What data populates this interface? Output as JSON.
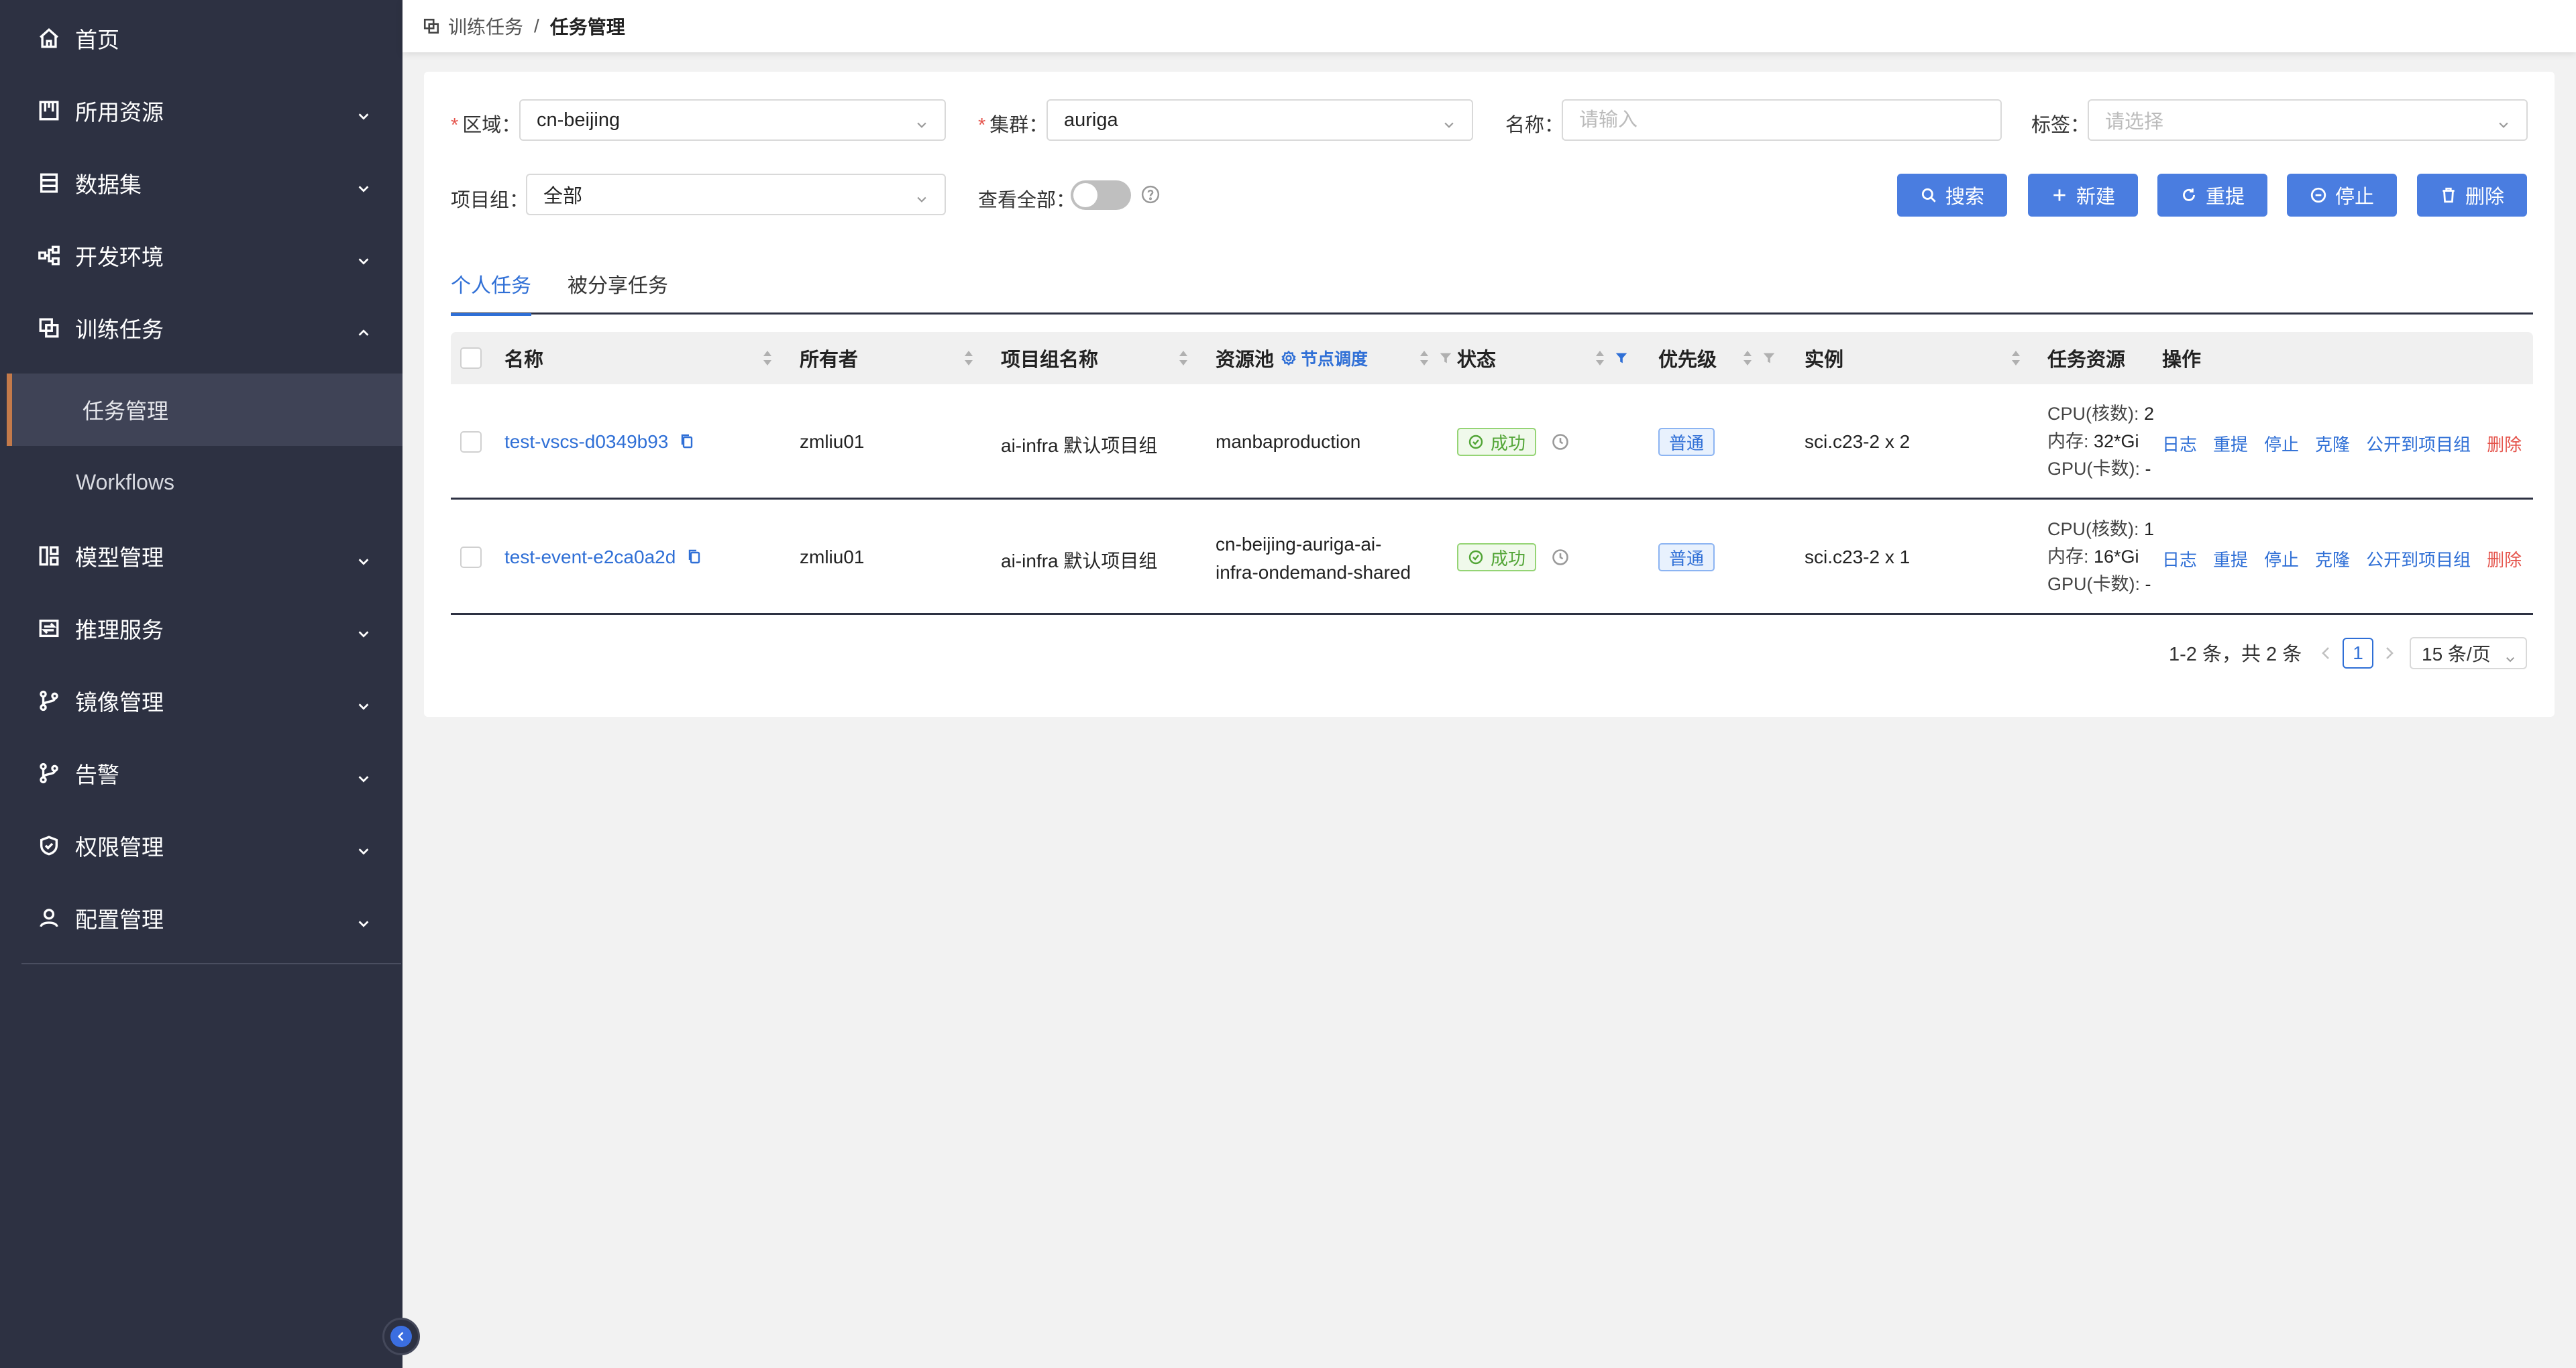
{
  "sidebar": {
    "items": [
      {
        "label": "首页",
        "icon": "home-icon"
      },
      {
        "label": "所用资源",
        "icon": "resource-icon"
      },
      {
        "label": "数据集",
        "icon": "dataset-icon"
      },
      {
        "label": "开发环境",
        "icon": "dev-env-icon"
      },
      {
        "label": "训练任务",
        "icon": "training-icon"
      },
      {
        "label": "模型管理",
        "icon": "model-icon"
      },
      {
        "label": "推理服务",
        "icon": "inference-icon"
      },
      {
        "label": "镜像管理",
        "icon": "image-branch-icon"
      },
      {
        "label": "告警",
        "icon": "alert-branch-icon"
      },
      {
        "label": "权限管理",
        "icon": "shield-icon"
      },
      {
        "label": "配置管理",
        "icon": "user-icon"
      }
    ],
    "sub_items": [
      {
        "label": "任务管理",
        "active": true
      },
      {
        "label": "Workflows",
        "active": false
      }
    ]
  },
  "breadcrumb": {
    "parent": "训练任务",
    "separator": "/",
    "current": "任务管理"
  },
  "filters": {
    "region": {
      "label": "区域",
      "value": "cn-beijing"
    },
    "cluster": {
      "label": "集群",
      "value": "auriga"
    },
    "name": {
      "label": "名称",
      "placeholder": "请输入"
    },
    "tags": {
      "label": "标签",
      "placeholder": "请选择"
    },
    "project_group": {
      "label": "项目组",
      "value": "全部"
    },
    "view_all": {
      "label": "查看全部",
      "checked": false
    },
    "colon": "："
  },
  "toolbar": {
    "search": "搜索",
    "create": "新建",
    "resubmit": "重提",
    "stop": "停止",
    "delete": "删除"
  },
  "tabs": [
    "个人任务",
    "被分享任务"
  ],
  "table": {
    "columns": {
      "name": "名称",
      "owner": "所有者",
      "project": "项目组名称",
      "pool": "资源池",
      "node_sched": "节点调度",
      "status": "状态",
      "priority": "优先级",
      "instance": "实例",
      "resources": "任务资源",
      "actions": "操作"
    },
    "rows": [
      {
        "name": "test-vscs-d0349b93",
        "owner": "zmliu01",
        "project": "ai-infra 默认项目组",
        "pool": [
          "manbaproduction"
        ],
        "status": "成功",
        "priority": "普通",
        "instance": "sci.c23-2 x 2",
        "cpu": "2",
        "mem": "32*Gi",
        "gpu": "-"
      },
      {
        "name": "test-event-e2ca0a2d",
        "owner": "zmliu01",
        "project": "ai-infra 默认项目组",
        "pool": [
          "cn-beijing-auriga-ai-",
          "infra-ondemand-shared"
        ],
        "status": "成功",
        "priority": "普通",
        "instance": "sci.c23-2 x 1",
        "cpu": "1",
        "mem": "16*Gi",
        "gpu": "-"
      }
    ],
    "resource_labels": {
      "cpu": "CPU(核数): ",
      "mem": "内存: ",
      "gpu": "GPU(卡数): "
    },
    "actions": [
      "日志",
      "重提",
      "停止",
      "克隆",
      "公开到项目组",
      "删除"
    ]
  },
  "pagination": {
    "total_text": "1-2 条，共 2 条",
    "current_page": "1",
    "page_size": "15 条/页"
  },
  "colors": {
    "sidebar_bg": "#2d3142",
    "primary": "#4a7de0",
    "link": "#2f6fd6",
    "success": "#52a536",
    "danger": "#e5534b",
    "active_marker": "#c47a4a"
  }
}
